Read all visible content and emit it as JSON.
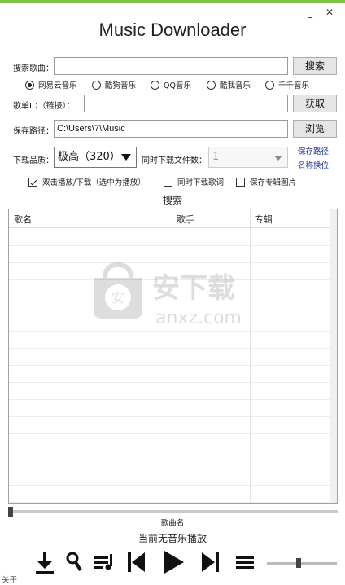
{
  "window": {
    "title": "Music Downloader",
    "minimize_glyph": "_",
    "close_glyph": "✕",
    "accent_color": "#7dc243"
  },
  "search": {
    "label": "搜索歌曲：",
    "value": "",
    "button": "搜索"
  },
  "sources": [
    {
      "label": "网易云音乐",
      "selected": true
    },
    {
      "label": "酷狗音乐",
      "selected": false
    },
    {
      "label": "QQ音乐",
      "selected": false
    },
    {
      "label": "酷我音乐",
      "selected": false
    },
    {
      "label": "千千音乐",
      "selected": false
    }
  ],
  "playlist": {
    "label": "歌单ID（链接）：",
    "value": "",
    "button": "获取"
  },
  "save_path": {
    "label": "保存路径：",
    "value": "C:\\Users\\7\\Music",
    "button": "浏览"
  },
  "quality": {
    "label": "下载品质：",
    "value": "极高（320）"
  },
  "concurrent": {
    "label": "同时下载文件数：",
    "value": "1"
  },
  "links": {
    "save_path_line1": "保存路径",
    "save_path_line2": "名称换位"
  },
  "options": [
    {
      "label": "双击播放/下载（选中为播放）",
      "checked": true
    },
    {
      "label": "同时下载歌词",
      "checked": false
    },
    {
      "label": "保存专辑图片",
      "checked": false
    }
  ],
  "results": {
    "title": "搜索",
    "columns": [
      "歌名",
      "歌手",
      "专辑"
    ],
    "rows": []
  },
  "watermark": {
    "text_cn": "安下载",
    "text_en": "anxz.com",
    "shield_char": "安"
  },
  "player": {
    "song_label": "歌曲名",
    "status": "当前无音乐播放",
    "progress": 0,
    "volume": 0.45
  },
  "footer": {
    "about": "关于"
  }
}
